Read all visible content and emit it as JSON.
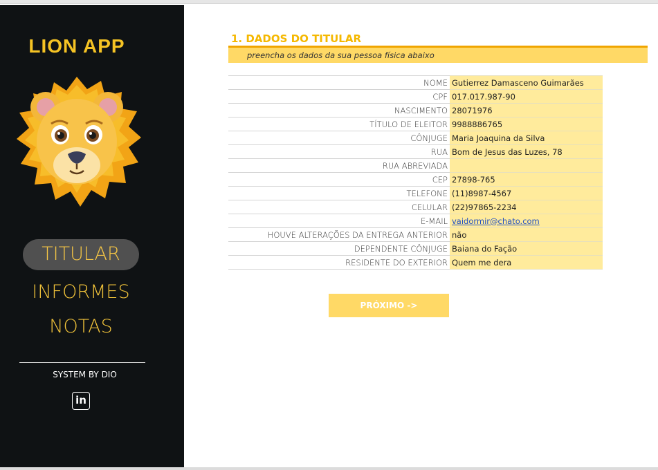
{
  "sidebar": {
    "app_title": "LION APP",
    "nav": [
      {
        "label": "TITULAR",
        "active": true
      },
      {
        "label": "INFORMES",
        "active": false
      },
      {
        "label": "NOTAS",
        "active": false
      }
    ],
    "footer": "SYSTEM BY DIO",
    "social_icon": "linkedin-icon",
    "social_text": "in",
    "logo_icon": "lion-icon"
  },
  "section": {
    "title": "1. DADOS DO TITULAR",
    "subtitle": "preencha os dados da sua pessoa física abaixo"
  },
  "form": {
    "rows": [
      {
        "label": "NOME",
        "value": "Gutierrez Damasceno Guimarães"
      },
      {
        "label": "CPF",
        "value": "017.017.987-90"
      },
      {
        "label": "NASCIMENTO",
        "value": "28071976"
      },
      {
        "label": "TÍTULO DE ELEITOR",
        "value": "9988886765"
      },
      {
        "label": "CÔNJUGE",
        "value": "Maria Joaquina da Silva"
      },
      {
        "label": "RUA",
        "value": "Bom de Jesus das Luzes, 78"
      },
      {
        "label": "RUA ABREVIADA",
        "value": ""
      },
      {
        "label": "CEP",
        "value": "27898-765"
      },
      {
        "label": "TELEFONE",
        "value": "(11)8987-4567"
      },
      {
        "label": "CELULAR",
        "value": "(22)97865-2234"
      },
      {
        "label": "E-MAIL",
        "value": "vaidormir@chato.com"
      },
      {
        "label": "HOUVE ALTERAÇÕES DA ENTREGA ANTERIOR",
        "value": "não"
      },
      {
        "label": "DEPENDENTE CÔNJUGE",
        "value": "Baiana do Fação"
      },
      {
        "label": "RESIDENTE DO EXTERIOR",
        "value": "Quem me dera"
      }
    ]
  },
  "button": {
    "next_label": "PRÓXIMO ->"
  },
  "colors": {
    "sidebar_bg": "#0f1214",
    "accent": "#f5c324",
    "field_bg": "#ffeb9c",
    "subtitle_bar": "#ffd966",
    "button_bg": "#ffd966"
  }
}
